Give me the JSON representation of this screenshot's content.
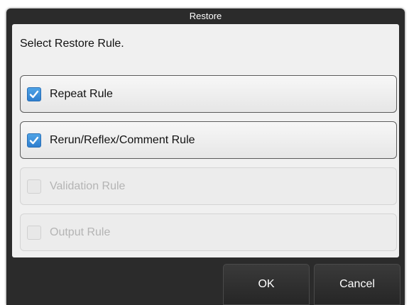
{
  "dialog": {
    "title": "Restore",
    "prompt": "Select Restore Rule.",
    "rules": [
      {
        "label": "Repeat Rule",
        "checked": true,
        "enabled": true
      },
      {
        "label": "Rerun/Reflex/Comment Rule",
        "checked": true,
        "enabled": true
      },
      {
        "label": "Validation Rule",
        "checked": false,
        "enabled": false
      },
      {
        "label": "Output Rule",
        "checked": false,
        "enabled": false
      }
    ],
    "buttons": {
      "ok": "OK",
      "cancel": "Cancel"
    }
  },
  "colors": {
    "accent": "#2f7fcf",
    "dialog_frame": "#2b2b2b",
    "content_bg": "#f0f0f0",
    "disabled_text": "#b4b4b4"
  },
  "icons": {
    "checkmark": "checkmark-icon"
  }
}
